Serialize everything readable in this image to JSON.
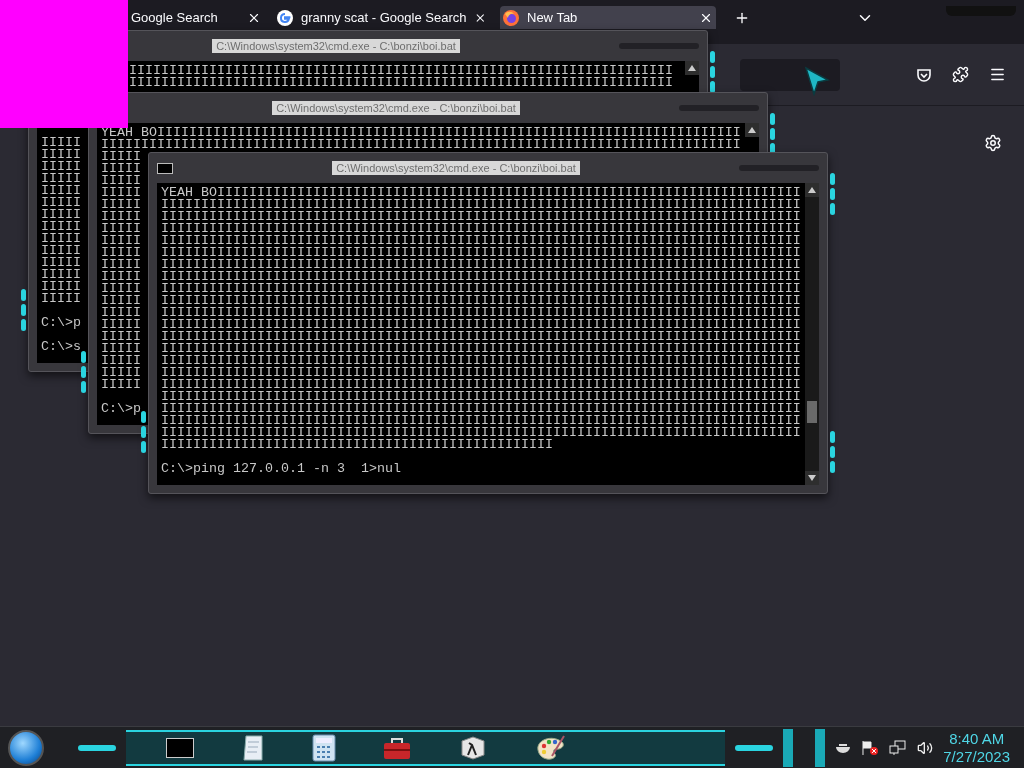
{
  "browser": {
    "tabs": [
      {
        "title": "Google Search",
        "selected": false,
        "kind": "plain"
      },
      {
        "title": "granny scat - Google Search",
        "selected": false,
        "kind": "google"
      },
      {
        "title": "New Tab",
        "selected": true,
        "kind": "firefox"
      }
    ]
  },
  "windows": [
    {
      "title": "C:\\Windows\\system32\\cmd.exe - C:\\bonzi\\boi.bat",
      "lines": [
        "IIIIIIIIIIIIIIIIIIIIIIIIIIIIIIIIIIIIIIIIIIIIIIIIIIIIIIIIIIIIIIIIIIII",
        "IIIIIIIIIIIIIIIIIIIIIIIIIIIIIIIIIIIIIIIIIIIIIIIIIIIIIIIIIIIIIIIIIIII",
        "IIIII",
        "IIIII",
        "IIIII",
        "IIIII",
        "IIIII",
        "IIIII",
        "IIIII",
        "IIIII",
        "IIIII",
        "IIIII",
        "IIIII",
        "IIIII",
        "IIIII",
        "IIIII"
      ],
      "prompts": [
        "C:\\>p",
        "C:\\>s"
      ]
    },
    {
      "title": "C:\\Windows\\system32\\cmd.exe - C:\\bonzi\\boi.bat",
      "lines": [
        "YEAH BOIIIIIIIIIIIIIIIIIIIIIIIIIIIIIIIIIIIIIIIIIIIIIIIIIIIIIIIIIIIIIIIIIIIIIIIII",
        "IIIIIIIIIIIIIIIIIIIIIIIIIIIIIIIIIIIIIIIIIIIIIIIIIIIIIIIIIIIIIIIIIIIIIIIIIIIIIIII",
        "IIIII",
        "IIIII",
        "IIIII",
        "IIIII",
        "IIIII",
        "IIIII",
        "IIIII",
        "IIIII",
        "IIIII",
        "IIIII",
        "IIIII",
        "IIIII",
        "IIIII",
        "IIIII",
        "IIIII",
        "IIIII",
        "IIIII",
        "IIIII",
        "IIIII",
        "IIIII"
      ],
      "prompts": [
        "C:\\>p"
      ]
    },
    {
      "title": "C:\\Windows\\system32\\cmd.exe - C:\\bonzi\\boi.bat",
      "lines": [
        "YEAH BOIIIIIIIIIIIIIIIIIIIIIIIIIIIIIIIIIIIIIIIIIIIIIIIIIIIIIIIIIIIIIIIIIIIIIIIII",
        "IIIIIIIIIIIIIIIIIIIIIIIIIIIIIIIIIIIIIIIIIIIIIIIIIIIIIIIIIIIIIIIIIIIIIIIIIIIIIIII",
        "IIIIIIIIIIIIIIIIIIIIIIIIIIIIIIIIIIIIIIIIIIIIIIIIIIIIIIIIIIIIIIIIIIIIIIIIIIIIIIII",
        "IIIIIIIIIIIIIIIIIIIIIIIIIIIIIIIIIIIIIIIIIIIIIIIIIIIIIIIIIIIIIIIIIIIIIIIIIIIIIIII",
        "IIIIIIIIIIIIIIIIIIIIIIIIIIIIIIIIIIIIIIIIIIIIIIIIIIIIIIIIIIIIIIIIIIIIIIIIIIIIIIII",
        "IIIIIIIIIIIIIIIIIIIIIIIIIIIIIIIIIIIIIIIIIIIIIIIIIIIIIIIIIIIIIIIIIIIIIIIIIIIIIIII",
        "IIIIIIIIIIIIIIIIIIIIIIIIIIIIIIIIIIIIIIIIIIIIIIIIIIIIIIIIIIIIIIIIIIIIIIIIIIIIIIII",
        "IIIIIIIIIIIIIIIIIIIIIIIIIIIIIIIIIIIIIIIIIIIIIIIIIIIIIIIIIIIIIIIIIIIIIIIIIIIIIIII",
        "IIIIIIIIIIIIIIIIIIIIIIIIIIIIIIIIIIIIIIIIIIIIIIIIIIIIIIIIIIIIIIIIIIIIIIIIIIIIIIII",
        "IIIIIIIIIIIIIIIIIIIIIIIIIIIIIIIIIIIIIIIIIIIIIIIIIIIIIIIIIIIIIIIIIIIIIIIIIIIIIIII",
        "IIIIIIIIIIIIIIIIIIIIIIIIIIIIIIIIIIIIIIIIIIIIIIIIIIIIIIIIIIIIIIIIIIIIIIIIIIIIIIII",
        "IIIIIIIIIIIIIIIIIIIIIIIIIIIIIIIIIIIIIIIIIIIIIIIIIIIIIIIIIIIIIIIIIIIIIIIIIIIIIIII",
        "IIIIIIIIIIIIIIIIIIIIIIIIIIIIIIIIIIIIIIIIIIIIIIIIIIIIIIIIIIIIIIIIIIIIIIIIIIIIIIII",
        "IIIIIIIIIIIIIIIIIIIIIIIIIIIIIIIIIIIIIIIIIIIIIIIIIIIIIIIIIIIIIIIIIIIIIIIIIIIIIIII",
        "IIIIIIIIIIIIIIIIIIIIIIIIIIIIIIIIIIIIIIIIIIIIIIIIIIIIIIIIIIIIIIIIIIIIIIIIIIIIIIII",
        "IIIIIIIIIIIIIIIIIIIIIIIIIIIIIIIIIIIIIIIIIIIIIIIIIIIIIIIIIIIIIIIIIIIIIIIIIIIIIIII",
        "IIIIIIIIIIIIIIIIIIIIIIIIIIIIIIIIIIIIIIIIIIIIIIIIIIIIIIIIIIIIIIIIIIIIIIIIIIIIIIII",
        "IIIIIIIIIIIIIIIIIIIIIIIIIIIIIIIIIIIIIIIIIIIIIIIIIIIIIIIIIIIIIIIIIIIIIIIIIIIIIIII",
        "IIIIIIIIIIIIIIIIIIIIIIIIIIIIIIIIIIIIIIIIIIIIIIIIIIIIIIIIIIIIIIIIIIIIIIIIIIIIIIII",
        "IIIIIIIIIIIIIIIIIIIIIIIIIIIIIIIIIIIIIIIIIIIIIIIIIIIIIIIIIIIIIIIIIIIIIIIIIIIIIIII",
        "IIIIIIIIIIIIIIIIIIIIIIIIIIIIIIIIIIIIIIIIIIIIIIIIIIIIIIIIIIIIIIIIIIIIIIIIIIIIIIII",
        "IIIIIIIIIIIIIIIIIIIIIIIIIIIIIIIIIIIIIIIIIIIIIIIII"
      ],
      "prompts": [
        "C:\\>ping 127.0.0.1 -n 3  1>nul"
      ]
    }
  ],
  "taskbar": {
    "time": "8:40 AM",
    "date": "7/27/2023"
  }
}
